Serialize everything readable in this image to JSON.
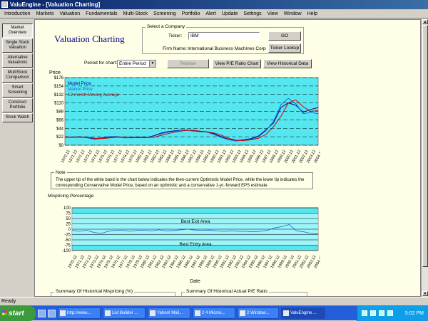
{
  "window": {
    "title": "ValuEngine - [Valuation Charting]"
  },
  "menu": [
    "Introduction",
    "Markets",
    "Valuation",
    "Fundamentals",
    "Multi-Stock",
    "Screening",
    "Portfolio",
    "Alert",
    "Update",
    "Settings",
    "View",
    "Window",
    "Help"
  ],
  "sidebar": [
    {
      "label": "Market\nOverview",
      "active": true
    },
    {
      "label": "Single Stock\nValuation",
      "active": false
    },
    {
      "label": "Alternative\nValuations",
      "active": false
    },
    {
      "label": "MultiStock\nComparison",
      "active": false
    },
    {
      "label": "Smart\nScreening",
      "active": false
    },
    {
      "label": "Construct\nPortfolio",
      "active": false
    },
    {
      "label": "Stock Watch",
      "active": false
    }
  ],
  "page": {
    "title": "Valuation Charting"
  },
  "company": {
    "group_label": "Select a Company",
    "ticker_label": "Ticker:",
    "ticker_value": "IBM",
    "firm_label": "Firm Name:",
    "firm_value": "International Business Machines Corporatio",
    "go_label": "GO",
    "lookup_label": "Ticker Lookup"
  },
  "controls": {
    "period_label": "Period for chart:",
    "period_value": "Entire Period",
    "redraw_label": "Redraw",
    "pe_label": "View P/E Ratio Chart",
    "hist_label": "View Historical Data"
  },
  "note": {
    "label": "Note",
    "text": "The upper tip of the white band in the chart below indicates the then-current Optimistic Model Price, while the lower tip indicates the corresponding Conservative Model Price, based on an optimistic and a conservative 1-yr.-forward EPS estimate."
  },
  "mispricing": {
    "label": "Mispricing Percentage"
  },
  "summary": {
    "left": "Summary Of Historical Mispricing (%)",
    "right": "Summary Of Historical Actual P/E Ratio"
  },
  "status": {
    "text": "Ready"
  },
  "taskbar": {
    "start": "start",
    "items": [
      "http://www...",
      "List Builder ...",
      "Yahoo! Mail...",
      "2 4 Micros...",
      "2 Window...",
      "ValuEngine ..."
    ],
    "clock": "5:02 PM"
  },
  "colors": {
    "chart_bg": "#55e7f0",
    "model": "#00008b",
    "market": "#1e5fd8",
    "ma": "#d00000",
    "band": "#ffffff"
  },
  "chart_data": [
    {
      "type": "line",
      "ylabel": "Price",
      "xlabel": "Date",
      "yticks": [
        "$0",
        "$22",
        "$44",
        "$66",
        "$88",
        "$110",
        "$132",
        "$154",
        "$176"
      ],
      "ylim": [
        0,
        176
      ],
      "grid": "dashed horizontal",
      "legend": "top-left",
      "x": [
        "1970.12",
        "1971.12",
        "1972.12",
        "1973.12",
        "1974.12",
        "1975.12",
        "1976.12",
        "1977.12",
        "1978.12",
        "1979.12",
        "1980.12",
        "1981.12",
        "1982.12",
        "1983.12",
        "1984.12",
        "1985.12",
        "1986.12",
        "1987.12",
        "1988.12",
        "1989.12",
        "1990.12",
        "1991.12",
        "1992.12",
        "1993.12",
        "1994.12",
        "1995.12",
        "1996.12",
        "1997.12",
        "1998.12",
        "1999.12",
        "2000.12",
        "2001.12",
        "2002.12",
        "2003.12",
        "2004.12"
      ],
      "series": [
        {
          "name": "Model Price",
          "values": [
            21,
            21,
            22,
            20,
            17,
            19,
            22,
            22,
            20,
            20,
            21,
            20,
            25,
            32,
            36,
            38,
            40,
            38,
            36,
            35,
            30,
            22,
            15,
            12,
            14,
            17,
            24,
            40,
            58,
            98,
            110,
            104,
            86,
            93,
            98
          ]
        },
        {
          "name": "Market Price",
          "values": [
            20,
            20,
            21,
            19,
            15,
            18,
            21,
            21,
            19,
            19,
            20,
            19,
            24,
            30,
            34,
            37,
            40,
            37,
            35,
            34,
            28,
            20,
            14,
            11,
            13,
            15,
            22,
            38,
            62,
            105,
            122,
            108,
            82,
            85,
            82
          ]
        },
        {
          "name": "12-month Moving Average",
          "values": [
            22,
            21,
            21,
            21,
            18,
            17,
            19,
            21,
            21,
            20,
            20,
            20,
            21,
            26,
            31,
            35,
            38,
            39,
            37,
            35,
            32,
            26,
            18,
            13,
            12,
            14,
            18,
            28,
            48,
            75,
            110,
            118,
            100,
            88,
            90
          ]
        }
      ]
    },
    {
      "type": "line",
      "ylabel": "Mispricing Percentage",
      "xlabel": "Date",
      "yticks": [
        "-100",
        "-75",
        "-50",
        "-25",
        "0",
        "25",
        "50",
        "75",
        "100"
      ],
      "ylim": [
        -100,
        100
      ],
      "annotations": [
        "Best Exit Area",
        "Best Entry Area"
      ],
      "x": [
        "1970.12",
        "1971.12",
        "1972.12",
        "1973.12",
        "1974.12",
        "1975.12",
        "1976.12",
        "1977.12",
        "1978.12",
        "1979.12",
        "1980.12",
        "1981.12",
        "1982.12",
        "1983.12",
        "1984.12",
        "1985.12",
        "1986.12",
        "1987.12",
        "1988.12",
        "1989.12",
        "1990.12",
        "1991.12",
        "1992.12",
        "1993.12",
        "1994.12",
        "1995.12",
        "1996.12",
        "1997.12",
        "1998.12",
        "1999.12",
        "2000.12",
        "2001.12",
        "2002.12",
        "2003.12",
        "2004.12"
      ],
      "series": [
        {
          "name": "",
          "values": [
            -5,
            -10,
            -5,
            -15,
            -20,
            -10,
            -5,
            -5,
            -10,
            -5,
            -5,
            -8,
            -3,
            -8,
            -6,
            -3,
            0,
            -4,
            -5,
            -4,
            -8,
            -10,
            -8,
            -10,
            -10,
            -12,
            -10,
            -5,
            6,
            12,
            22,
            -8,
            -12,
            -20,
            -22
          ]
        }
      ]
    }
  ]
}
